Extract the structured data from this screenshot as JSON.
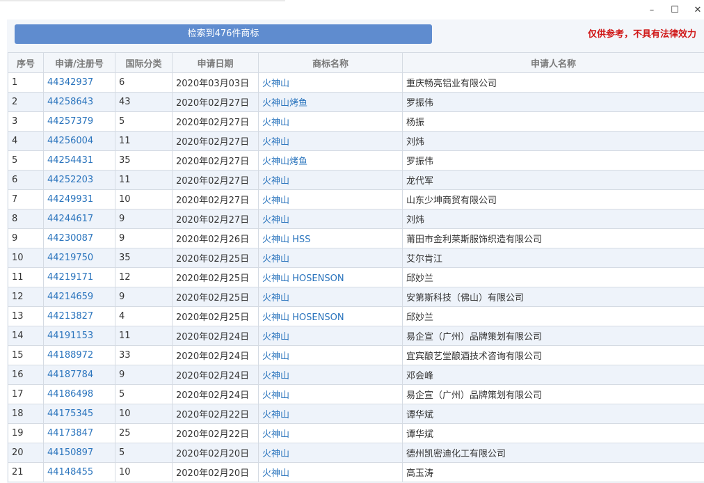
{
  "window": {
    "minimize": "–",
    "maximize": "☐",
    "close": "✕"
  },
  "search": {
    "result_text": "检索到476件商标"
  },
  "disclaimer": "仅供参考，不具有法律效力",
  "table": {
    "headers": [
      "序号",
      "申请/注册号",
      "国际分类",
      "申请日期",
      "商标名称",
      "申请人名称"
    ],
    "rows": [
      [
        "1",
        "44342937",
        "6",
        "2020年03月03日",
        "火神山",
        "重庆畅亮铝业有限公司"
      ],
      [
        "2",
        "44258643",
        "43",
        "2020年02月27日",
        "火神山烤鱼",
        "罗振伟"
      ],
      [
        "3",
        "44257379",
        "5",
        "2020年02月27日",
        "火神山",
        "杨振"
      ],
      [
        "4",
        "44256004",
        "11",
        "2020年02月27日",
        "火神山",
        "刘炜"
      ],
      [
        "5",
        "44254431",
        "35",
        "2020年02月27日",
        "火神山烤鱼",
        "罗振伟"
      ],
      [
        "6",
        "44252203",
        "11",
        "2020年02月27日",
        "火神山",
        "龙代军"
      ],
      [
        "7",
        "44249931",
        "10",
        "2020年02月27日",
        "火神山",
        "山东少坤商贸有限公司"
      ],
      [
        "8",
        "44244617",
        "9",
        "2020年02月27日",
        "火神山",
        "刘炜"
      ],
      [
        "9",
        "44230087",
        "9",
        "2020年02月26日",
        "火神山 HSS",
        "莆田市金利莱斯服饰织造有限公司"
      ],
      [
        "10",
        "44219750",
        "35",
        "2020年02月25日",
        "火神山",
        "艾尔肯江"
      ],
      [
        "11",
        "44219171",
        "12",
        "2020年02月25日",
        "火神山 HOSENSON",
        "邱妙兰"
      ],
      [
        "12",
        "44214659",
        "9",
        "2020年02月25日",
        "火神山",
        "安第斯科技（佛山）有限公司"
      ],
      [
        "13",
        "44213827",
        "4",
        "2020年02月25日",
        "火神山 HOSENSON",
        "邱妙兰"
      ],
      [
        "14",
        "44191153",
        "11",
        "2020年02月24日",
        "火神山",
        "易企宣（广州）品牌策划有限公司"
      ],
      [
        "15",
        "44188972",
        "33",
        "2020年02月24日",
        "火神山",
        "宜宾酿艺堂酿酒技术咨询有限公司"
      ],
      [
        "16",
        "44187784",
        "9",
        "2020年02月24日",
        "火神山",
        "邓会峰"
      ],
      [
        "17",
        "44186498",
        "5",
        "2020年02月24日",
        "火神山",
        "易企宣（广州）品牌策划有限公司"
      ],
      [
        "18",
        "44175345",
        "10",
        "2020年02月22日",
        "火神山",
        "谭华斌"
      ],
      [
        "19",
        "44173847",
        "25",
        "2020年02月22日",
        "火神山",
        "谭华斌"
      ],
      [
        "20",
        "44150897",
        "5",
        "2020年02月20日",
        "火神山",
        "德州凯密迪化工有限公司"
      ],
      [
        "21",
        "44148455",
        "10",
        "2020年02月20日",
        "火神山",
        "高玉涛"
      ]
    ]
  }
}
